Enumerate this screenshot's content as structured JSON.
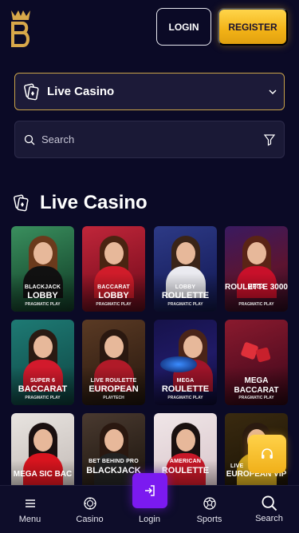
{
  "header": {
    "logo_icon": "brand-b-crown-logo",
    "login_label": "LOGIN",
    "register_label": "REGISTER"
  },
  "category": {
    "label": "Live Casino",
    "icon": "live-casino-cards-icon",
    "chevron": "chevron-down-icon"
  },
  "search": {
    "placeholder": "Search",
    "icon": "search-icon",
    "filter_icon": "filter-icon"
  },
  "section": {
    "title": "Live Casino",
    "icon": "live-casino-cards-icon"
  },
  "games": [
    {
      "t1": "BLACKJACK",
      "t2": "LOBBY",
      "t3": "PRAGMATIC PLAY"
    },
    {
      "t1": "BACCARAT",
      "t2": "LOBBY",
      "t3": "PRAGMATIC PLAY"
    },
    {
      "t1": "LOBBY",
      "t2": "ROULETTE",
      "t3": "PRAGMATIC PLAY"
    },
    {
      "t1": "MEGA",
      "t2": "ROULETTE 3000",
      "t3": "PRAGMATIC PLAY"
    },
    {
      "t1": "SUPER 6",
      "t2": "BACCARAT",
      "t3": "PRAGMATIC PLAY"
    },
    {
      "t1": "LIVE ROULETTE",
      "t2": "EUROPEAN",
      "t3": "PLAYTECH"
    },
    {
      "t1": "MEGA",
      "t2": "ROULETTE",
      "t3": "PRAGMATIC PLAY"
    },
    {
      "t1": "",
      "t2": "MEGA BACCARAT",
      "t3": "PRAGMATIC PLAY"
    },
    {
      "t1": "",
      "t2": "MEGA SIC BAC",
      "t3": ""
    },
    {
      "t1": "BET BEHIND PRO",
      "t2": "BLACKJACK",
      "t3": ""
    },
    {
      "t1": "AMERICAN",
      "t2": "ROULETTE",
      "t3": ""
    },
    {
      "t1": "LIVE",
      "t2": "EUROPEAN VIP",
      "t3": ""
    }
  ],
  "support": {
    "icon": "headset-support-icon"
  },
  "login_fab": {
    "icon": "login-arrow-icon"
  },
  "bottom_nav": [
    {
      "label": "Menu",
      "icon": "hamburger-menu-icon"
    },
    {
      "label": "Casino",
      "icon": "casino-chip-icon"
    },
    {
      "label": "Login",
      "icon": "login-arrow-icon"
    },
    {
      "label": "Sports",
      "icon": "sports-ball-icon"
    },
    {
      "label": "Search",
      "icon": "search-icon"
    }
  ],
  "colors": {
    "background": "#0b0a26",
    "accent_gold": "#f2b216",
    "accent_purple": "#7b1af0"
  }
}
